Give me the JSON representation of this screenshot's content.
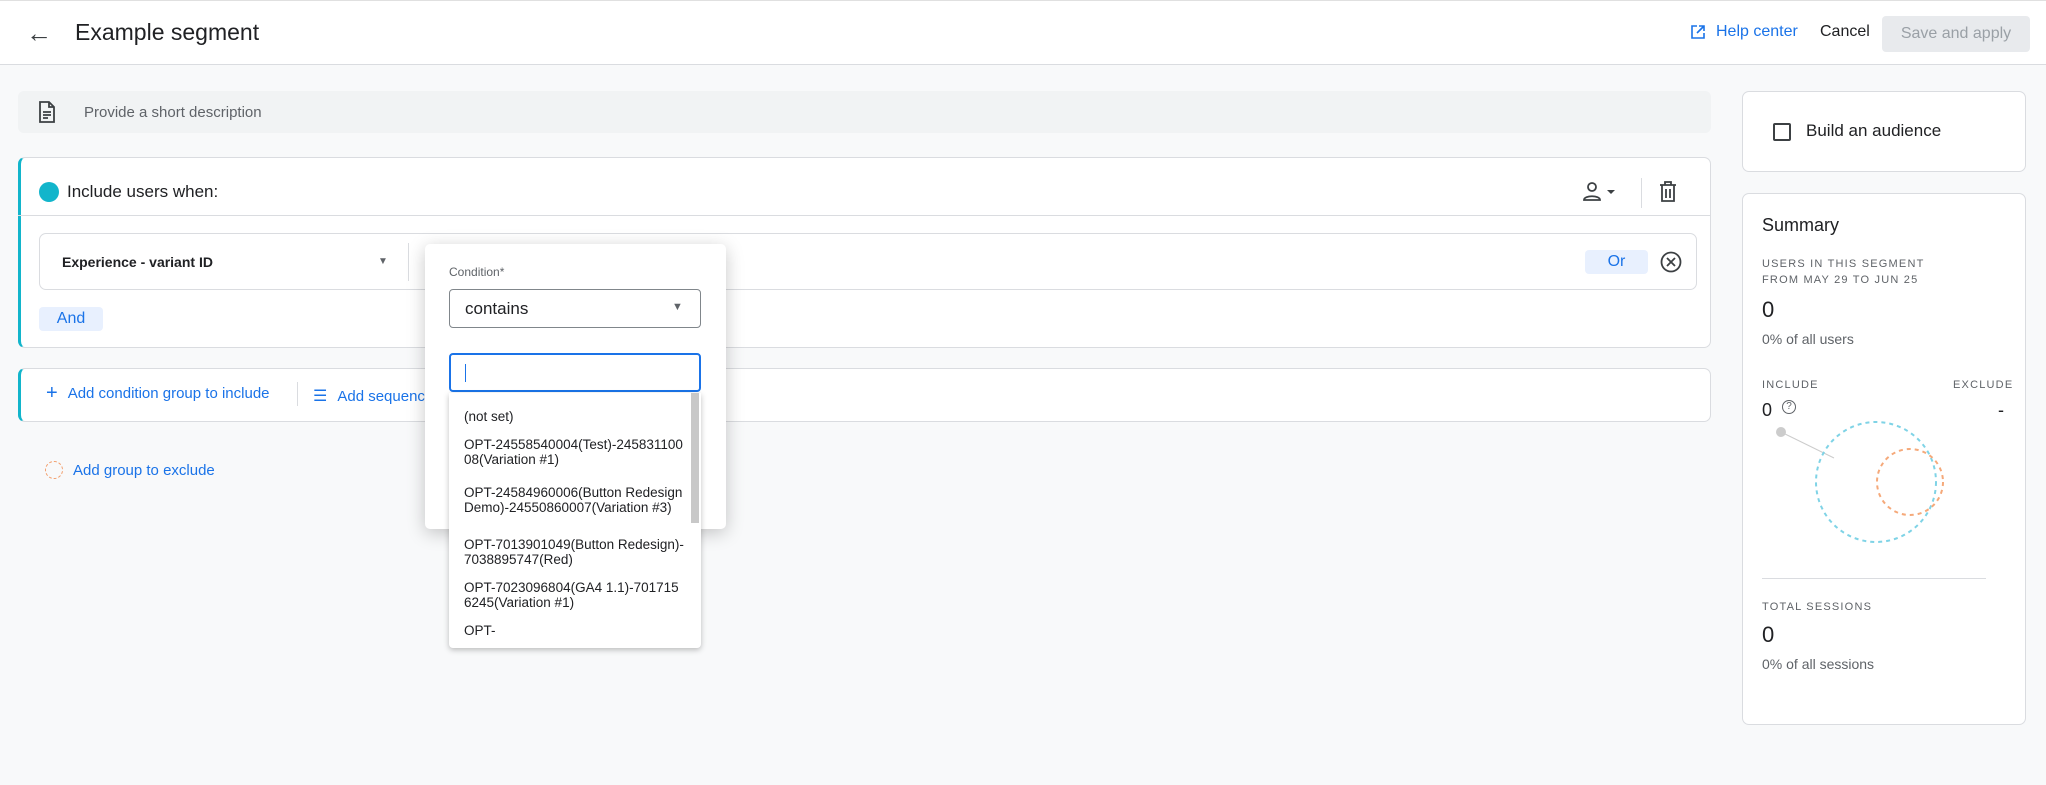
{
  "header": {
    "title": "Example segment",
    "help_center": "Help center",
    "cancel": "Cancel",
    "save_and_apply": "Save and apply"
  },
  "description": {
    "placeholder": "Provide a short description"
  },
  "include_group": {
    "title": "Include users when:",
    "dimension": "Experience - variant ID",
    "or_label": "Or",
    "and_label": "And"
  },
  "actions": {
    "add_condition_group": "Add condition group to include",
    "add_sequence": "Add sequence",
    "add_exclude": "Add group to exclude"
  },
  "popup": {
    "condition_label": "Condition*",
    "condition_value": "contains",
    "input_value": "",
    "options": [
      "(not set)",
      "OPT-24558540004(Test)-24583110008(Variation #1)",
      "OPT-24584960006(Button Redesign Demo)-24550860007(Variation #3)",
      "OPT-7013901049(Button Redesign)-7038895747(Red)",
      "OPT-7023096804(GA4 1.1)-7017156245(Variation #1)",
      "OPT-"
    ]
  },
  "audience": {
    "label": "Build an audience",
    "checked": false
  },
  "summary": {
    "title": "Summary",
    "users_label_1": "USERS IN THIS SEGMENT",
    "users_label_2": "FROM MAY 29 TO JUN 25",
    "users_value": "0",
    "users_pct": "0% of all users",
    "include_label": "INCLUDE",
    "exclude_label": "EXCLUDE",
    "include_value": "0",
    "exclude_value": "-",
    "sessions_label": "TOTAL SESSIONS",
    "sessions_value": "0",
    "sessions_pct": "0% of all sessions"
  },
  "colors": {
    "accent": "#1a73e8",
    "include": "#12b5cb",
    "exclude": "#f29f6d"
  }
}
